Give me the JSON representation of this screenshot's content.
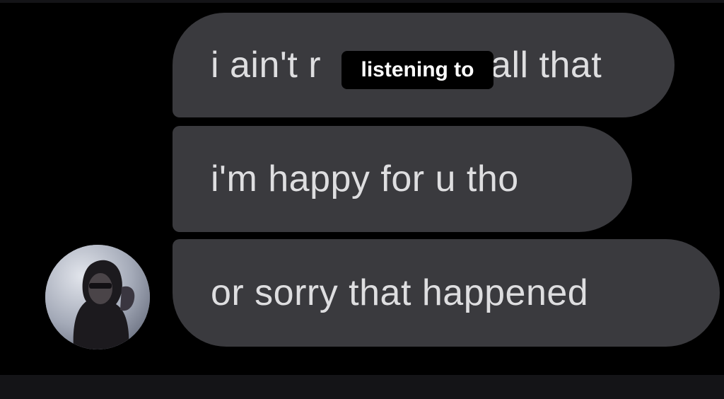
{
  "conversation": {
    "messages": [
      {
        "text": "i ain't r",
        "text_after": "all that"
      },
      {
        "text": "i'm happy for u tho"
      },
      {
        "text": "or sorry that happened"
      }
    ],
    "sender_avatar": {
      "icon": "profile-photo-avatar"
    }
  },
  "overlay_caption": {
    "text": "listening to"
  },
  "colors": {
    "background": "#000000",
    "bubble": "#3a3a3e",
    "bubble_text": "#dedee0",
    "caption_bg": "#000000",
    "caption_text": "#ffffff"
  }
}
